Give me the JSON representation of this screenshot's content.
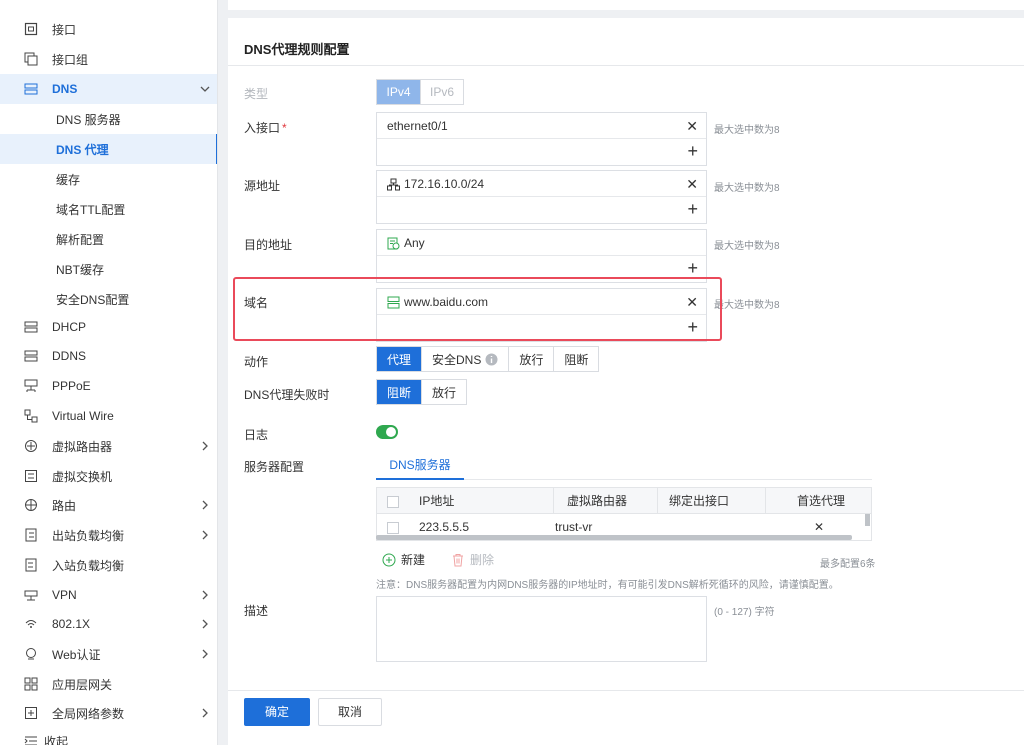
{
  "sidebar": {
    "items": [
      {
        "label": "接口",
        "icon": "interface-icon"
      },
      {
        "label": "接口组",
        "icon": "interface-group-icon"
      },
      {
        "label": "DNS",
        "icon": "dns-icon"
      },
      {
        "label": "DNS 服务器"
      },
      {
        "label": "DNS 代理"
      },
      {
        "label": "缓存"
      },
      {
        "label": "域名TTL配置"
      },
      {
        "label": "解析配置"
      },
      {
        "label": "NBT缓存"
      },
      {
        "label": "安全DNS配置"
      },
      {
        "label": "DHCP",
        "icon": "dhcp-icon"
      },
      {
        "label": "DDNS",
        "icon": "ddns-icon"
      },
      {
        "label": "PPPoE",
        "icon": "pppoe-icon"
      },
      {
        "label": "Virtual Wire",
        "icon": "virtual-wire-icon"
      },
      {
        "label": "虚拟路由器",
        "icon": "virtual-router-icon"
      },
      {
        "label": "虚拟交换机",
        "icon": "virtual-switch-icon"
      },
      {
        "label": "路由",
        "icon": "route-icon"
      },
      {
        "label": "出站负载均衡",
        "icon": "outbound-lb-icon"
      },
      {
        "label": "入站负载均衡",
        "icon": "inbound-lb-icon"
      },
      {
        "label": "VPN",
        "icon": "vpn-icon"
      },
      {
        "label": "802.1X",
        "icon": "wifi-8021x-icon"
      },
      {
        "label": "Web认证",
        "icon": "web-auth-icon"
      },
      {
        "label": "应用层网关",
        "icon": "app-gateway-icon"
      },
      {
        "label": "全局网络参数",
        "icon": "global-params-icon"
      },
      {
        "label": "收起",
        "icon": "collapse-icon"
      }
    ]
  },
  "panel": {
    "title": "DNS代理规则配置"
  },
  "form": {
    "type_label": "类型",
    "type_options": [
      "IPv4",
      "IPv6"
    ],
    "ingress_label": "入接口",
    "ingress_required": "*",
    "ingress_value": "ethernet0/1",
    "src_label": "源地址",
    "src_value": "172.16.10.0/24",
    "dst_label": "目的地址",
    "dst_value": "Any",
    "domain_label": "域名",
    "domain_value": "www.baidu.com",
    "max_hint": "最大选中数为8",
    "action_label": "动作",
    "action_options": [
      "代理",
      "安全DNS",
      "放行",
      "阻断"
    ],
    "fail_label": "DNS代理失败时",
    "fail_options": [
      "阻断",
      "放行"
    ],
    "log_label": "日志",
    "log_enabled": true,
    "server_label": "服务器配置",
    "server_tab": "DNS服务器",
    "table_headers": [
      "IP地址",
      "虚拟路由器",
      "绑定出接口",
      "首选代理"
    ],
    "table_rows": [
      {
        "ip": "223.5.5.5",
        "vr": "trust-vr",
        "iface": "",
        "preferred": "✕"
      }
    ],
    "new_label": "新建",
    "delete_label": "删除",
    "max_servers": "最多配置6条",
    "note": "注意：DNS服务器配置为内网DNS服务器的IP地址时，有可能引发DNS解析死循环的风险，请谨慎配置。",
    "desc_label": "描述",
    "desc_hint": "(0 - 127) 字符"
  },
  "footer": {
    "ok": "确定",
    "cancel": "取消"
  },
  "colors": {
    "accent": "#1e6fd9",
    "highlight": "#ea4a5a",
    "toggle_on": "#2fa84f"
  }
}
